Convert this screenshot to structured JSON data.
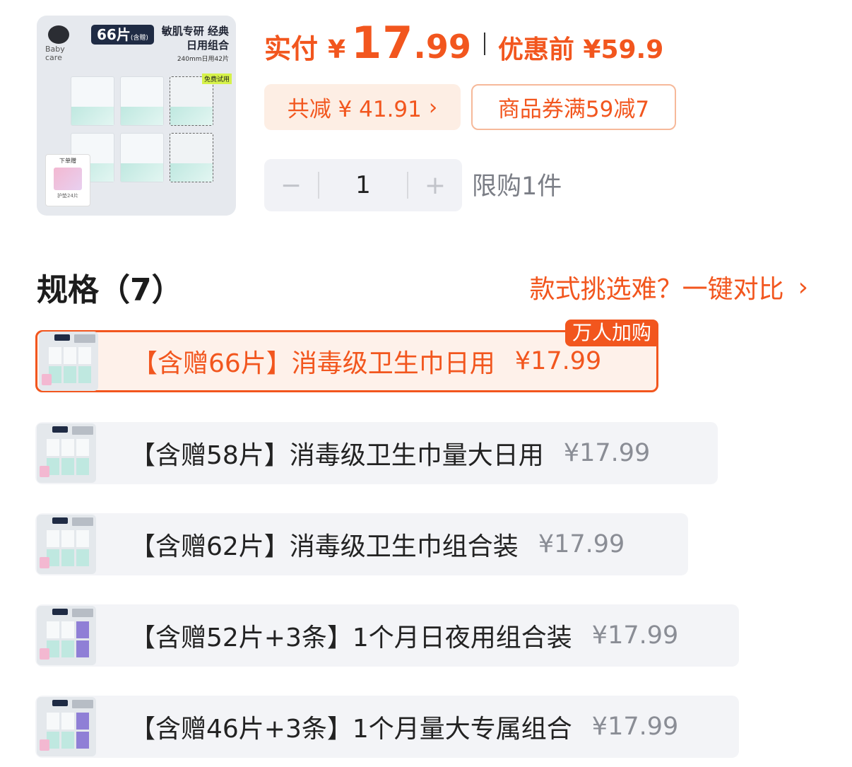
{
  "product": {
    "thumb_badge": "66片",
    "thumb_badge_small": "(含赠)",
    "thumb_title": "敏肌专研 经典日用组合",
    "thumb_sub": "240mm日用42片",
    "thumb_brand": "Baby care",
    "thumb_gift_label": "下单赠",
    "thumb_gift_sub": "护垫24片",
    "thumb_trial": "免费试用"
  },
  "price": {
    "label": "实付",
    "yen": "¥",
    "integer": "17",
    "decimal": ".99",
    "original_label": "优惠前 ¥59.9"
  },
  "discount": {
    "text": "共减 ¥ 41.91",
    "chevron": "›"
  },
  "coupon": {
    "text": "商品券满59减7"
  },
  "quantity": {
    "minus": "−",
    "value": "1",
    "plus": "+",
    "limit": "限购1件"
  },
  "spec": {
    "title": "规格（7）",
    "compare_link": "款式挑选难？一键对比",
    "compare_chevron": "›",
    "options": [
      {
        "name": "【含赠66片】消毒级卫生巾日用",
        "price": "¥17.99",
        "tag": "万人加购",
        "selected": true
      },
      {
        "name": "【含赠58片】消毒级卫生巾量大日用",
        "price": "¥17.99"
      },
      {
        "name": "【含赠62片】消毒级卫生巾组合装",
        "price": "¥17.99"
      },
      {
        "name": "【含赠52片+3条】1个月日夜用组合装",
        "price": "¥17.99"
      },
      {
        "name": "【含赠46片+3条】1个月量大专属组合",
        "price": "¥17.99"
      }
    ]
  },
  "colors": {
    "accent": "#f2561e",
    "chip_bg": "#fdeee4",
    "option_bg": "#f3f4f7"
  }
}
